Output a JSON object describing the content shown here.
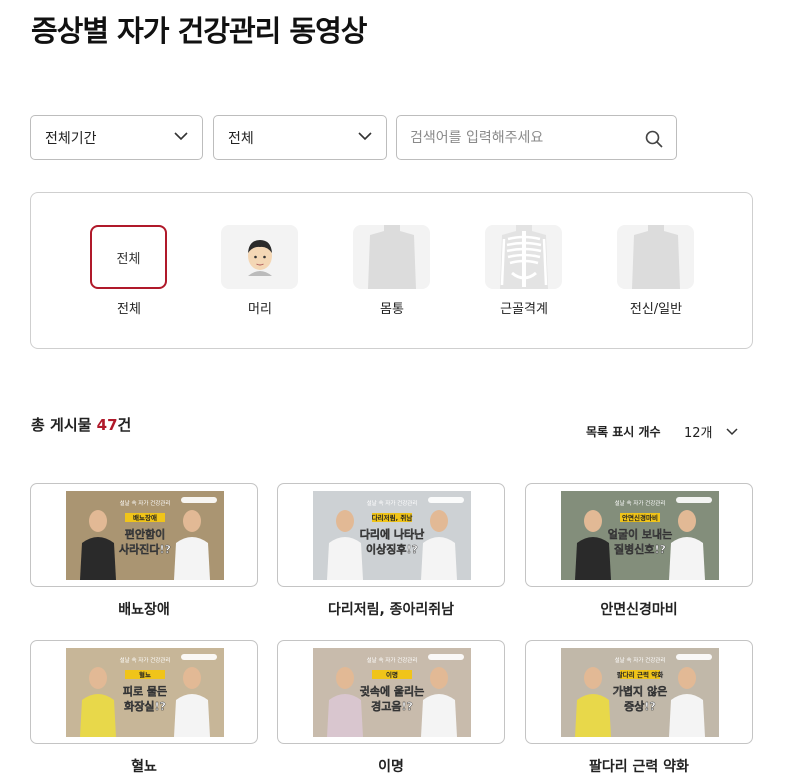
{
  "page": {
    "title": "증상별 자가 건강관리 동영상"
  },
  "filters": {
    "period_value": "전체기간",
    "type_value": "전체",
    "search_placeholder": "검색어를 입력해주세요"
  },
  "categories": [
    {
      "label": "전체",
      "thumb_text": "전체",
      "active": true,
      "icon": "all"
    },
    {
      "label": "머리",
      "active": false,
      "icon": "head-icon"
    },
    {
      "label": "몸통",
      "active": false,
      "icon": "torso-icon"
    },
    {
      "label": "근골격계",
      "active": false,
      "icon": "skeleton-icon"
    },
    {
      "label": "전신/일반",
      "active": false,
      "icon": "fullbody-icon"
    }
  ],
  "list": {
    "count_prefix": "총 게시물",
    "count": "47",
    "count_suffix": "건",
    "page_size_label": "목록 표시 개수",
    "page_size_value": "12개"
  },
  "videos": [
    {
      "title": "배뇨장애",
      "caption": "배뇨장애",
      "headline1": "편안함이",
      "headline2": "사라진다!?"
    },
    {
      "title": "다리저림, 종아리쥐남",
      "caption": "다리저림, 쥐남",
      "headline1": "다리에 나타난",
      "headline2": "이상징후!?"
    },
    {
      "title": "안면신경마비",
      "caption": "안면신경마비",
      "headline1": "얼굴이 보내는",
      "headline2": "질병신호!?"
    },
    {
      "title": "혈뇨",
      "caption": "혈뇨",
      "headline1": "피로 물든",
      "headline2": "화장실!?"
    },
    {
      "title": "이명",
      "caption": "이명",
      "headline1": "귓속에 울리는",
      "headline2": "경고음!?"
    },
    {
      "title": "팔다리 근력 약화",
      "caption": "팔다리 근력 약화",
      "headline1": "가볍지 않은",
      "headline2": "증상!?"
    }
  ],
  "thumbnail": {
    "series_label": "설날 속 자가 건강관리"
  },
  "colors": {
    "accent": "#b0192a",
    "thumb_headline": "#ffffff",
    "thumb_caption_bg": "#f0c419"
  }
}
